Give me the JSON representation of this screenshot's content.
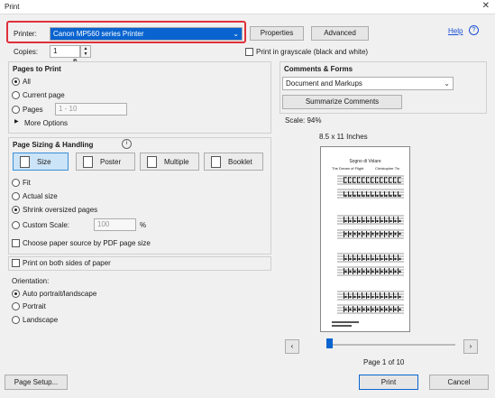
{
  "window": {
    "title": "Print",
    "close_icon": "close-icon"
  },
  "printer": {
    "label": "Printer:",
    "value": "Canon MP560 series Printer",
    "properties": "Properties",
    "advanced": "Advanced",
    "help": "Help"
  },
  "copies": {
    "label": "Copies:",
    "value": "1"
  },
  "grayscale": {
    "label": "Print in grayscale (black and white)",
    "checked": false
  },
  "pages_to_print": {
    "title": "Pages to Print",
    "options": [
      "All",
      "Current page",
      "Pages"
    ],
    "selected": "All",
    "pages_range": "1 - 10",
    "more_options": "More Options"
  },
  "sizing": {
    "title": "Page Sizing & Handling",
    "buttons": [
      "Size",
      "Poster",
      "Multiple",
      "Booklet"
    ],
    "active": "Size",
    "options": [
      "Fit",
      "Actual size",
      "Shrink oversized pages",
      "Custom Scale:"
    ],
    "selected": "Shrink oversized pages",
    "custom_scale": "100",
    "percent": "%",
    "paper_source": "Choose paper source by PDF page size",
    "both_sides": "Print on both sides of paper"
  },
  "orientation": {
    "title": "Orientation:",
    "options": [
      "Auto portrait/landscape",
      "Portrait",
      "Landscape"
    ],
    "selected": "Auto portrait/landscape"
  },
  "comments": {
    "title": "Comments & Forms",
    "value": "Document and Markups",
    "summarize": "Summarize Comments",
    "scale": "Scale:  94%",
    "paper": "8.5 x 11 Inches"
  },
  "preview": {
    "title": "Sogno di Volare",
    "subtitle": "The Dream of Flight",
    "composer": "Christopher Tin",
    "page_of": "Page 1 of 10",
    "page_fraction": 0.0
  },
  "footer": {
    "page_setup": "Page Setup...",
    "print": "Print",
    "cancel": "Cancel"
  },
  "colors": {
    "accent": "#0a64d0",
    "highlight": "#e0303a",
    "link": "#1a4fd6"
  }
}
